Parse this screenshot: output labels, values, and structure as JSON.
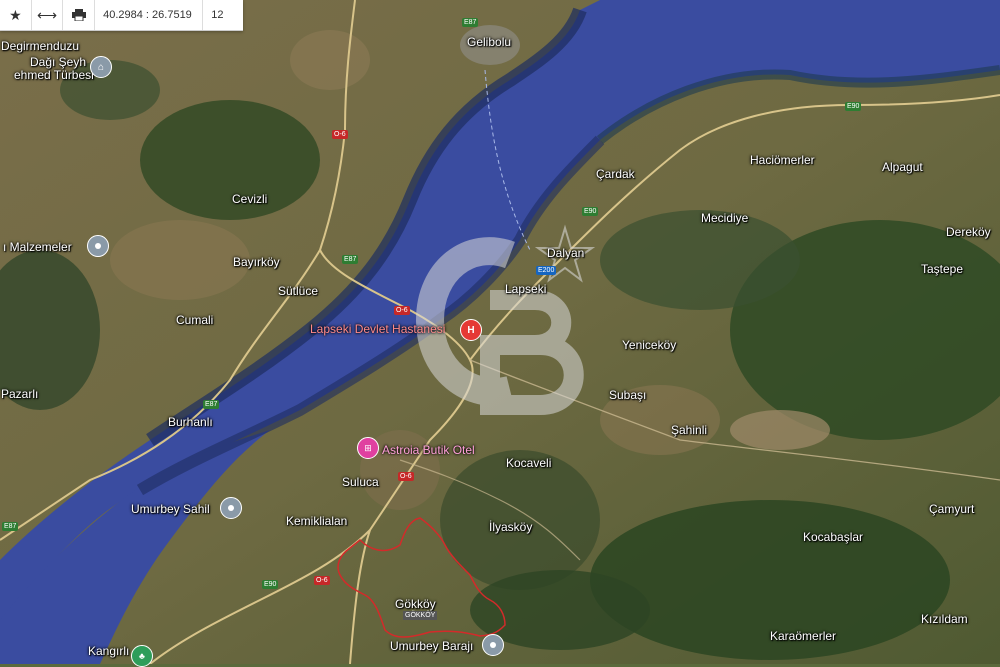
{
  "toolbar": {
    "coordinates": "40.2984 : 26.7519",
    "zoom_level": "12"
  },
  "places": {
    "gelibolu": "Gelibolu",
    "degirmenduzu": "Degirmenduzu",
    "dagi_seyh": "Dağı Şeyh",
    "mehmed_turbesi": "ehmed Türbesi",
    "cevizli": "Cevizli",
    "malzemeler": "ı Malzemeler",
    "bayirkoy": "Bayırköy",
    "sutluce": "Sütlüce",
    "cumali": "Cumali",
    "pazarli": "Pazarlı",
    "burhanli": "Burhanlı",
    "haciomerler": "Haciömerler",
    "alpagut": "Alpagut",
    "cardak": "Çardak",
    "mecidiye": "Mecidiye",
    "derekoy": "Dereköy",
    "dalyan": "Dalyan",
    "tastepe": "Taştepe",
    "lapseki": "Lapseki",
    "yenicekoy": "Yeniceköy",
    "subasi": "Subaşı",
    "sahinli": "Şahinli",
    "kocaveli": "Kocaveli",
    "suluca": "Suluca",
    "kemiklialan": "Kemiklialan",
    "ilyaskoy": "İlyasköy",
    "camyurt": "Çamyurt",
    "kocabaslar": "Kocabaşlar",
    "gokkoy": "Gökköy",
    "gokkoy_sub": "GÖKKÖY",
    "kizildam": "Kızıldam",
    "karaomerler": "Karaömerler",
    "umurbey_baraji": "Umurbey Barajı",
    "kangirli": "Kangırlı"
  },
  "pois": {
    "hospital": "Lapseki Devlet Hastanesi",
    "hotel": "Astroia Butik Otel",
    "umurbey_sahil": "Umurbey Sahil"
  },
  "roads": {
    "e87": "E87",
    "e90": "E90",
    "o6": "O-6",
    "e200": "E200"
  },
  "colors": {
    "sea": "#3c4fa8",
    "land": "#6b6a42",
    "forest": "#2f4a24",
    "boundary": "#d42a2a",
    "watermark": "#d0d0d0"
  },
  "watermark": "CB"
}
